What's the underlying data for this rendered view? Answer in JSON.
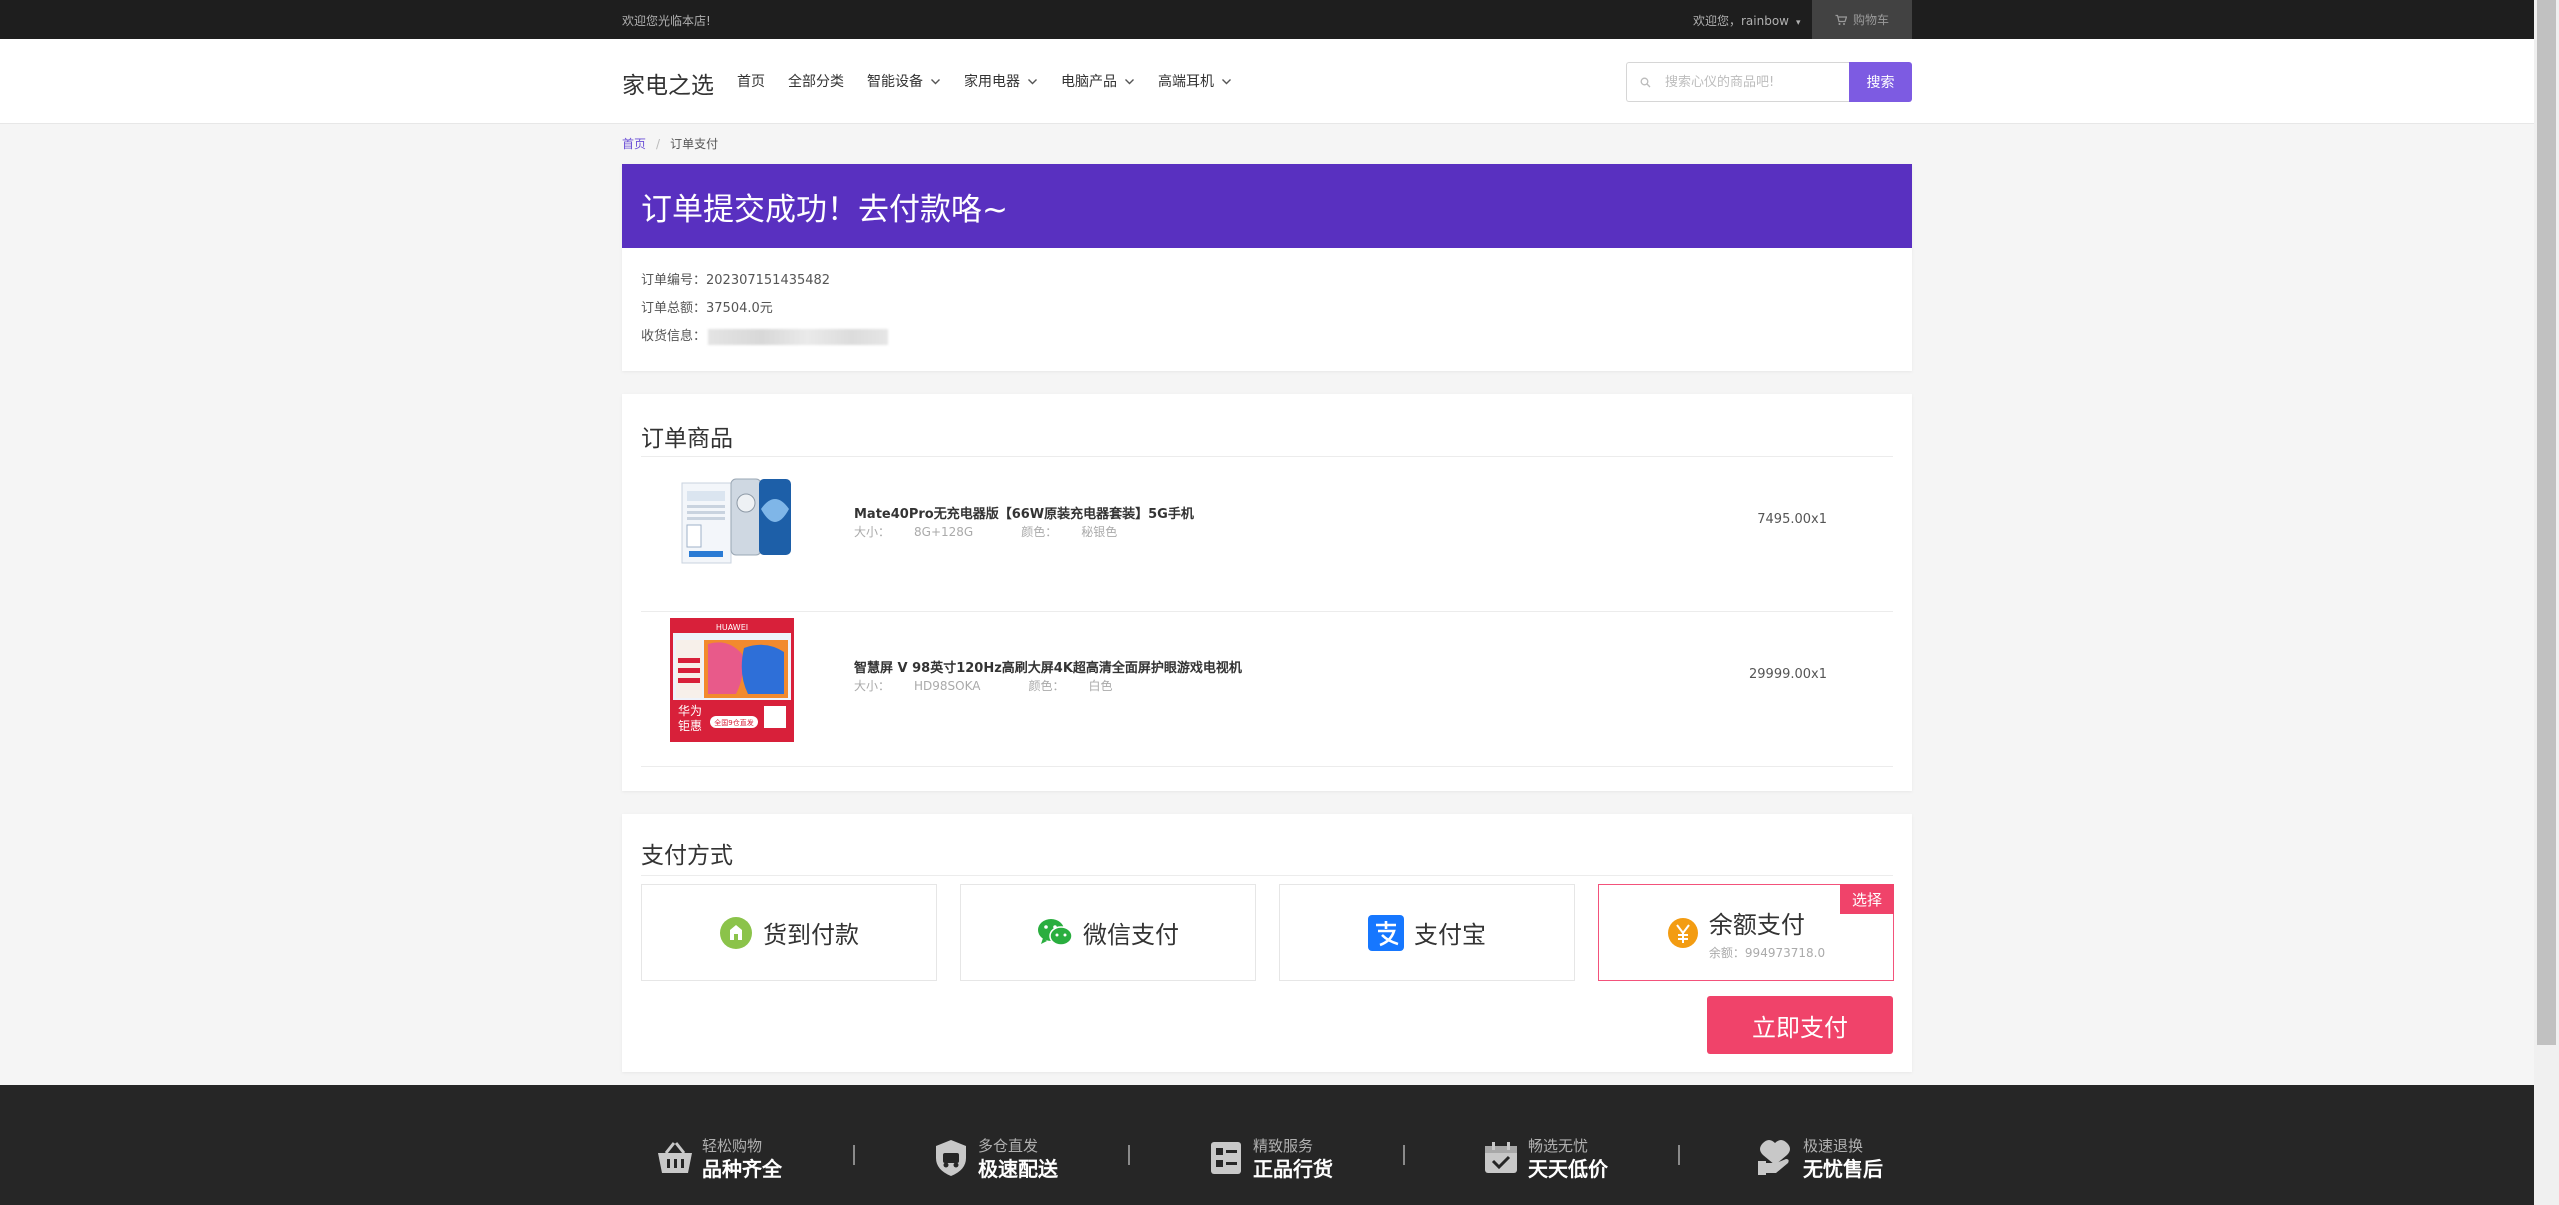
{
  "topbar": {
    "welcome": "欢迎您光临本店!",
    "user": "欢迎您，rainbow",
    "cart": "购物车"
  },
  "header": {
    "logo": "家电之选",
    "nav": [
      {
        "label": "首页",
        "dropdown": false
      },
      {
        "label": "全部分类",
        "dropdown": false
      },
      {
        "label": "智能设备",
        "dropdown": true
      },
      {
        "label": "家用电器",
        "dropdown": true
      },
      {
        "label": "电脑产品",
        "dropdown": true
      },
      {
        "label": "高端耳机",
        "dropdown": true
      }
    ],
    "search": {
      "placeholder": "搜索心仪的商品吧!",
      "value": "",
      "button": "搜索"
    }
  },
  "breadcrumb": {
    "home": "首页",
    "separator": "/",
    "current": "订单支付"
  },
  "order": {
    "banner": "订单提交成功！去付款咯~",
    "number_label": "订单编号：",
    "number": "202307151435482",
    "total_label": "订单总额：",
    "total": "37504.0元",
    "address_label": "收货信息："
  },
  "products": {
    "title": "订单商品",
    "items": [
      {
        "name": "Mate40Pro无充电器版【66W原装充电器套装】5G手机",
        "size_label": "大小：",
        "size": "8G+128G",
        "color_label": "颜色：",
        "color": "秘银色",
        "price": "7495.00x1"
      },
      {
        "name": "智慧屏 V 98英寸120Hz高刷大屏4K超高清全面屏护眼游戏电视机",
        "size_label": "大小：",
        "size": "HD98SOKA",
        "color_label": "颜色：",
        "color": "白色",
        "price": "29999.00x1",
        "image_texts": [
          "HUAWEI",
          "华为",
          "钜惠",
          "全国9仓直发"
        ]
      }
    ]
  },
  "payment": {
    "title": "支付方式",
    "options": [
      {
        "label": "货到付款",
        "icon": "cash-on-delivery-icon",
        "color": "#8bc34a"
      },
      {
        "label": "微信支付",
        "icon": "wechat-icon",
        "color": "#2aae3f"
      },
      {
        "label": "支付宝",
        "icon": "alipay-icon",
        "color": "#1677ff"
      },
      {
        "label": "余额支付",
        "icon": "yen-coin-icon",
        "color": "#f39c12",
        "balance_label": "余额：",
        "balance": "994973718.0",
        "selected": true
      }
    ],
    "selected_tag": "选择",
    "pay_button": "立即支付"
  },
  "footer": {
    "features": [
      {
        "line1": "轻松购物",
        "line2": "品种齐全",
        "icon": "shopping-basket-icon"
      },
      {
        "line1": "多仓直发",
        "line2": "极速配送",
        "icon": "delivery-shield-icon"
      },
      {
        "line1": "精致服务",
        "line2": "正品行货",
        "icon": "checklist-icon"
      },
      {
        "line1": "畅选无忧",
        "line2": "天天低价",
        "icon": "calendar-price-icon"
      },
      {
        "line1": "极速退换",
        "line2": "无忧售后",
        "icon": "refund-hand-icon"
      }
    ]
  },
  "colors": {
    "accent": "#7d5be2",
    "banner": "#5930c0",
    "pay": "#f0436a",
    "topbar": "#1e1e1e",
    "footer": "#262626"
  }
}
